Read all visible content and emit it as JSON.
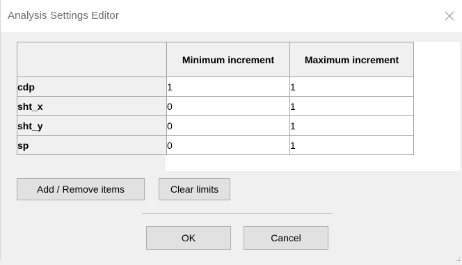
{
  "window": {
    "title": "Analysis Settings Editor"
  },
  "grid": {
    "columns": [
      "",
      "Minimum increment",
      "Maximum increment"
    ],
    "rows": [
      {
        "name": "cdp",
        "min": "1",
        "max": "1"
      },
      {
        "name": "sht_x",
        "min": "0",
        "max": "1"
      },
      {
        "name": "sht_y",
        "min": "0",
        "max": "1"
      },
      {
        "name": "sp",
        "min": "0",
        "max": "1"
      }
    ]
  },
  "buttons": {
    "add_remove": "Add / Remove items",
    "clear_limits": "Clear limits",
    "ok": "OK",
    "cancel": "Cancel"
  },
  "icons": {
    "close": "close-icon",
    "resize": "resize-grip-icon"
  }
}
